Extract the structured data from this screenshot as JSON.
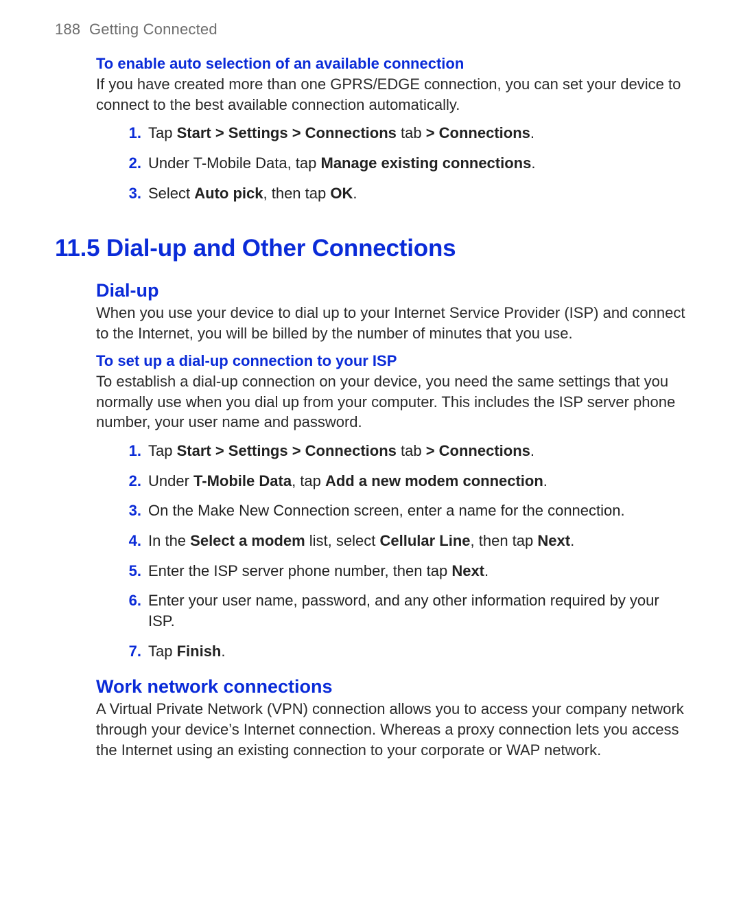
{
  "header": {
    "page_number": "188",
    "chapter": "Getting Connected"
  },
  "s1": {
    "title": "To enable auto selection of an available connection",
    "para": "If you have created more than one GPRS/EDGE connection, you can set your device to connect to the best available connection automatically.",
    "steps": [
      {
        "pre": "Tap ",
        "b1": "Start > Settings > Connections",
        "mid": " tab ",
        "b2": "> Connections",
        "post": "."
      },
      {
        "pre": "Under T-Mobile Data, tap ",
        "b1": "Manage existing connections",
        "post": "."
      },
      {
        "pre": "Select ",
        "b1": "Auto pick",
        "mid": ", then tap ",
        "b2": "OK",
        "post": "."
      }
    ]
  },
  "h1": "11.5  Dial-up and Other Connections",
  "s2": {
    "h2": "Dial-up",
    "para": "When you use your device to dial up to your Internet Service Provider (ISP) and connect to the Internet, you will be billed by the number of minutes that you use.",
    "sub_title": "To set up a dial-up connection to your ISP",
    "sub_para": "To establish a dial-up connection on your device, you need the same settings that you normally use when you dial up from your computer. This includes the ISP server phone number, your user name and password.",
    "steps": [
      {
        "pre": "Tap ",
        "b1": "Start > Settings > Connections",
        "mid": " tab ",
        "b2": "> Connections",
        "post": "."
      },
      {
        "pre": "Under ",
        "b1": "T-Mobile Data",
        "mid": ", tap ",
        "b2": "Add a new modem connection",
        "post": "."
      },
      {
        "pre": "On the Make New Connection screen, enter a name for the connection."
      },
      {
        "pre": "In the ",
        "b1": "Select a modem",
        "mid": " list, select ",
        "b2": "Cellular Line",
        "mid2": ", then tap ",
        "b3": "Next",
        "post": "."
      },
      {
        "pre": "Enter the ISP server phone number, then tap ",
        "b1": "Next",
        "post": "."
      },
      {
        "pre": "Enter your user name, password, and any other information required by your ISP."
      },
      {
        "pre": "Tap ",
        "b1": "Finish",
        "post": "."
      }
    ]
  },
  "s3": {
    "h2": "Work network connections",
    "para": "A Virtual Private Network (VPN) connection allows you to access your company network through your device’s Internet connection. Whereas a proxy connection lets you access the Internet using an existing connection to your corporate or WAP network."
  }
}
